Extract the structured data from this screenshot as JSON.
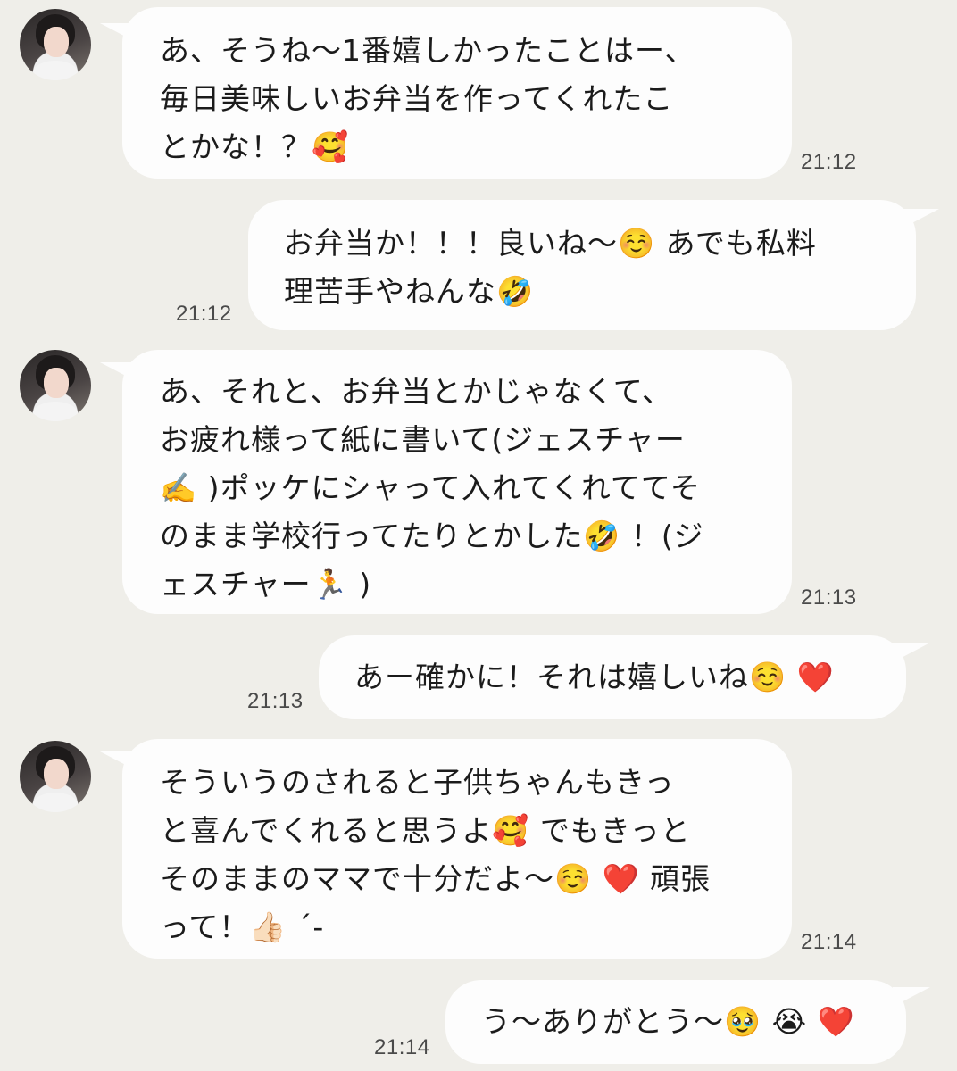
{
  "messages": [
    {
      "sender": "them",
      "lines": [
        "あ、そうね〜1番嬉しかったことはー、",
        "毎日美味しいお弁当を作ってくれたこ",
        "とかな！？🥰"
      ],
      "time": "21:12"
    },
    {
      "sender": "me",
      "lines": [
        "お弁当か！！！良いね〜☺️ あでも私料",
        "理苦手やねんな🤣"
      ],
      "time": "21:12"
    },
    {
      "sender": "them",
      "lines": [
        "あ、それと、お弁当とかじゃなくて、",
        "お疲れ様って紙に書いて(ジェスチャー",
        "✍️ )ポッケにシャって入れてくれててそ",
        "のまま学校行ってたりとかした🤣 ！(ジ",
        "ェスチャー🏃 )"
      ],
      "time": "21:13"
    },
    {
      "sender": "me",
      "lines": [
        "あー確かに！それは嬉しいね☺️ ❤️"
      ],
      "time": "21:13"
    },
    {
      "sender": "them",
      "lines": [
        "そういうのされると子供ちゃんもきっ",
        "と喜んでくれると思うよ🥰 でもきっと",
        "そのままのママで十分だよ〜☺️ ❤️ 頑張",
        "って！👍🏻 ´-"
      ],
      "time": "21:14"
    },
    {
      "sender": "me",
      "lines": [
        "う〜ありがとう〜🥹 😭 ❤️"
      ],
      "time": "21:14"
    }
  ]
}
